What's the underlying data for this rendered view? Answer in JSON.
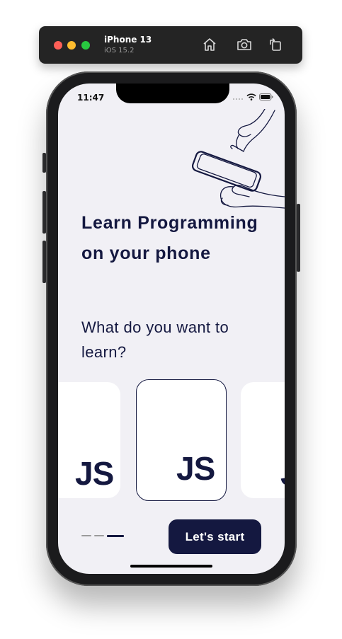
{
  "simulator": {
    "device_name": "iPhone 13",
    "os_version": "iOS 15.2",
    "buttons": [
      {
        "icon": "home-icon"
      },
      {
        "icon": "screenshot-icon"
      },
      {
        "icon": "rotate-icon"
      }
    ]
  },
  "status_bar": {
    "time": "11:47",
    "icons": [
      "cellular-icon",
      "wifi-icon",
      "battery-icon"
    ]
  },
  "onboarding": {
    "headline": "Learn Programming on your phone",
    "subtitle": "What do you want to learn?",
    "cards": [
      {
        "label": "JS",
        "selected": false
      },
      {
        "label": "JS",
        "selected": true
      },
      {
        "label": "JS",
        "selected": false
      }
    ],
    "pager": {
      "count": 3,
      "active_index": 2
    },
    "start_label": "Let's start"
  },
  "colors": {
    "primary": "#141840",
    "screen_bg": "#f1f0f5",
    "card_bg": "#ffffff",
    "inactive_dot": "#9b9b9b"
  }
}
